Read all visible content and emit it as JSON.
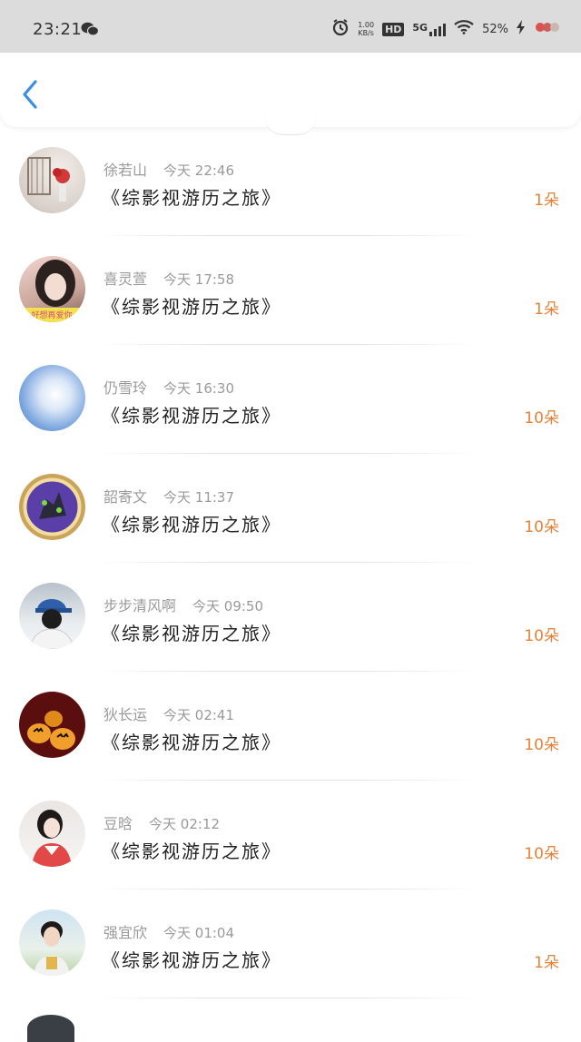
{
  "status_bar": {
    "time": "23:21",
    "network_speed": "1.00",
    "network_speed_unit": "KB/s",
    "hd_label": "HD",
    "signal_label": "5G",
    "battery": "52%"
  },
  "header": {
    "back_icon": "chevron-left-icon"
  },
  "items": [
    {
      "name": "徐若山",
      "time": "今天 22:46",
      "title": "《综影视游历之旅》",
      "flowers": "1朵"
    },
    {
      "name": "喜灵萱",
      "time": "今天 17:58",
      "title": "《综影视游历之旅》",
      "flowers": "1朵"
    },
    {
      "name": "仍雪玲",
      "time": "今天 16:30",
      "title": "《综影视游历之旅》",
      "flowers": "10朵"
    },
    {
      "name": "韶寄文",
      "time": "今天 11:37",
      "title": "《综影视游历之旅》",
      "flowers": "10朵"
    },
    {
      "name": "步步清风啊",
      "time": "今天 09:50",
      "title": "《综影视游历之旅》",
      "flowers": "10朵"
    },
    {
      "name": "狄长运",
      "time": "今天 02:41",
      "title": "《综影视游历之旅》",
      "flowers": "10朵"
    },
    {
      "name": "豆晗",
      "time": "今天 02:12",
      "title": "《综影视游历之旅》",
      "flowers": "10朵"
    },
    {
      "name": "强宜欣",
      "time": "今天 01:04",
      "title": "《综影视游历之旅》",
      "flowers": "1朵"
    }
  ],
  "avatar_caption": "好想再爱你",
  "colors": {
    "accent_orange": "#e6823a",
    "back_blue": "#3a8ee6",
    "status_bg": "#dcdcdc"
  }
}
